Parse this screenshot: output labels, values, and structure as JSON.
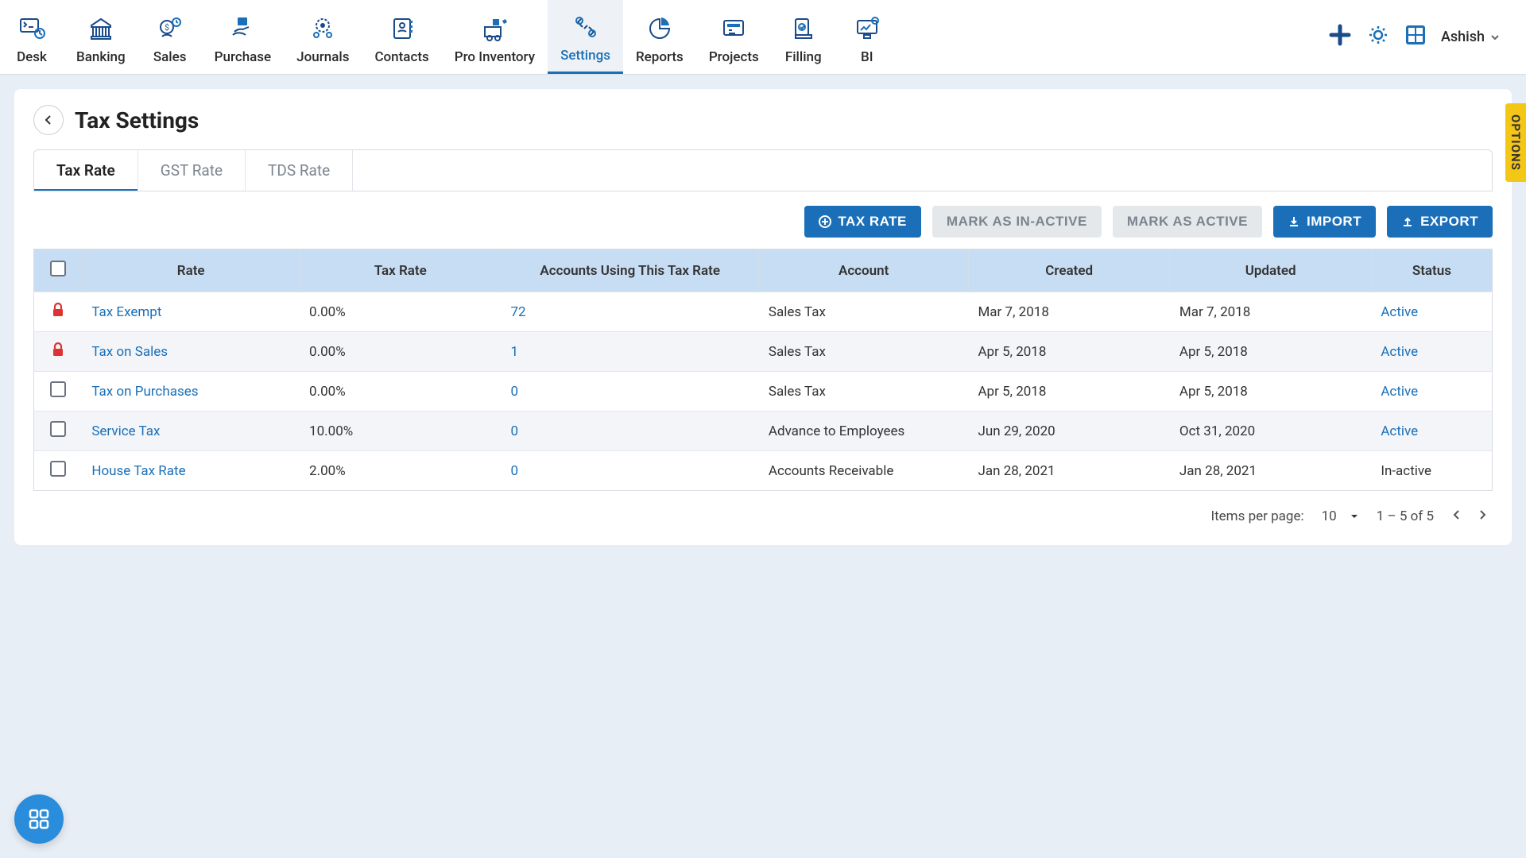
{
  "nav": {
    "items": [
      {
        "label": "Desk"
      },
      {
        "label": "Banking"
      },
      {
        "label": "Sales"
      },
      {
        "label": "Purchase"
      },
      {
        "label": "Journals"
      },
      {
        "label": "Contacts"
      },
      {
        "label": "Pro Inventory"
      },
      {
        "label": "Settings"
      },
      {
        "label": "Reports"
      },
      {
        "label": "Projects"
      },
      {
        "label": "Filling"
      },
      {
        "label": "BI"
      }
    ],
    "active_index": 7,
    "user": "Ashish"
  },
  "page": {
    "title": "Tax Settings"
  },
  "tabs": {
    "items": [
      "Tax Rate",
      "GST Rate",
      "TDS Rate"
    ],
    "active_index": 0
  },
  "actions": {
    "tax_rate": "TAX RATE",
    "mark_inactive": "MARK AS IN-ACTIVE",
    "mark_active": "MARK AS ACTIVE",
    "import": "IMPORT",
    "export": "EXPORT"
  },
  "table": {
    "columns": [
      "Rate",
      "Tax Rate",
      "Accounts Using This Tax Rate",
      "Account",
      "Created",
      "Updated",
      "Status"
    ],
    "rows": [
      {
        "locked": true,
        "rate": "Tax Exempt",
        "tax_rate": "0.00%",
        "accounts": "72",
        "account": "Sales Tax",
        "created": "Mar 7, 2018",
        "updated": "Mar 7, 2018",
        "status": "Active",
        "status_active": true
      },
      {
        "locked": true,
        "rate": "Tax on Sales",
        "tax_rate": "0.00%",
        "accounts": "1",
        "account": "Sales Tax",
        "created": "Apr 5, 2018",
        "updated": "Apr 5, 2018",
        "status": "Active",
        "status_active": true
      },
      {
        "locked": false,
        "rate": "Tax on Purchases",
        "tax_rate": "0.00%",
        "accounts": "0",
        "account": "Sales Tax",
        "created": "Apr 5, 2018",
        "updated": "Apr 5, 2018",
        "status": "Active",
        "status_active": true
      },
      {
        "locked": false,
        "rate": "Service Tax",
        "tax_rate": "10.00%",
        "accounts": "0",
        "account": "Advance to Employees",
        "created": "Jun 29, 2020",
        "updated": "Oct 31, 2020",
        "status": "Active",
        "status_active": true
      },
      {
        "locked": false,
        "rate": "House Tax Rate",
        "tax_rate": "2.00%",
        "accounts": "0",
        "account": "Accounts Receivable",
        "created": "Jan 28, 2021",
        "updated": "Jan 28, 2021",
        "status": "In-active",
        "status_active": false
      }
    ]
  },
  "pagination": {
    "items_per_page_label": "Items per page:",
    "items_per_page_value": "10",
    "range": "1 – 5 of 5"
  },
  "options_label": "OPTIONS"
}
